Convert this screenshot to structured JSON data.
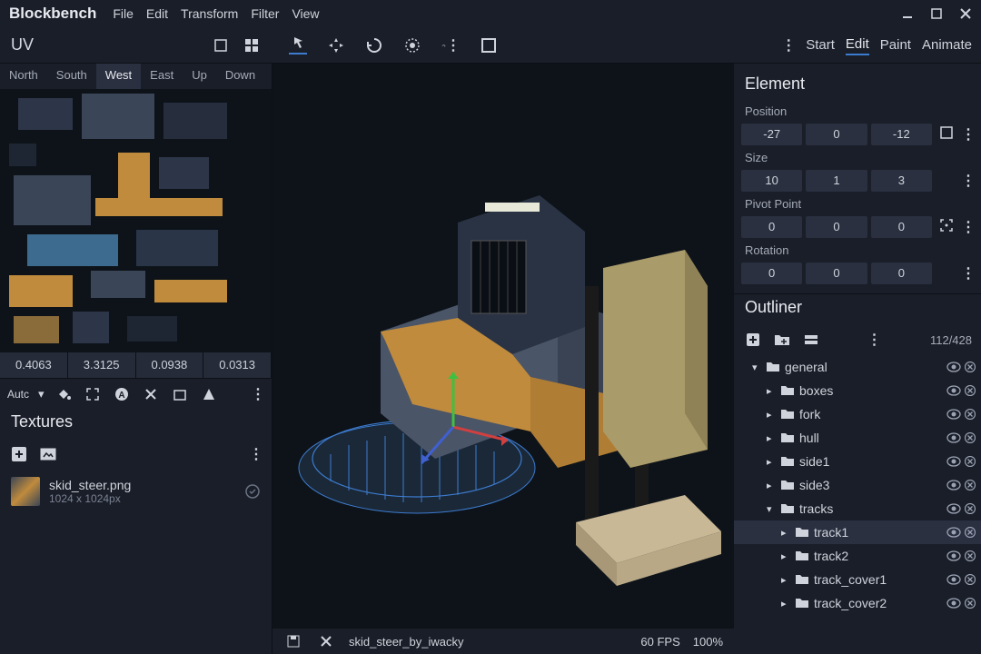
{
  "app_name": "Blockbench",
  "menu": [
    "File",
    "Edit",
    "Transform",
    "Filter",
    "View"
  ],
  "modes": {
    "items": [
      "Start",
      "Edit",
      "Paint",
      "Animate"
    ],
    "active": 1,
    "dots": "⋮"
  },
  "uv": {
    "title": "UV",
    "tabs": [
      "North",
      "South",
      "West",
      "East",
      "Up",
      "Down"
    ],
    "active_tab": 2,
    "coords": [
      "0.4063",
      "3.3125",
      "0.0938",
      "0.0313"
    ],
    "auto_label": "Autc"
  },
  "textures": {
    "title": "Textures",
    "item": {
      "name": "skid_steer.png",
      "size": "1024 x 1024px"
    }
  },
  "viewport": {
    "filename": "skid_steer_by_iwacky",
    "fps": "60 FPS",
    "zoom": "100%"
  },
  "element": {
    "title": "Element",
    "position": {
      "label": "Position",
      "x": "-27",
      "y": "0",
      "z": "-12"
    },
    "size": {
      "label": "Size",
      "x": "10",
      "y": "1",
      "z": "3"
    },
    "pivot": {
      "label": "Pivot Point",
      "x": "0",
      "y": "0",
      "z": "0"
    },
    "rotation": {
      "label": "Rotation",
      "x": "0",
      "y": "0",
      "z": "0"
    }
  },
  "outliner": {
    "title": "Outliner",
    "count": "112/428",
    "tree": [
      {
        "name": "general",
        "depth": 0,
        "expanded": true
      },
      {
        "name": "boxes",
        "depth": 1,
        "expanded": false
      },
      {
        "name": "fork",
        "depth": 1,
        "expanded": false
      },
      {
        "name": "hull",
        "depth": 1,
        "expanded": false
      },
      {
        "name": "side1",
        "depth": 1,
        "expanded": false
      },
      {
        "name": "side3",
        "depth": 1,
        "expanded": false
      },
      {
        "name": "tracks",
        "depth": 1,
        "expanded": true
      },
      {
        "name": "track1",
        "depth": 2,
        "expanded": false,
        "selected": true
      },
      {
        "name": "track2",
        "depth": 2,
        "expanded": false
      },
      {
        "name": "track_cover1",
        "depth": 2,
        "expanded": false
      },
      {
        "name": "track_cover2",
        "depth": 2,
        "expanded": false
      }
    ]
  }
}
